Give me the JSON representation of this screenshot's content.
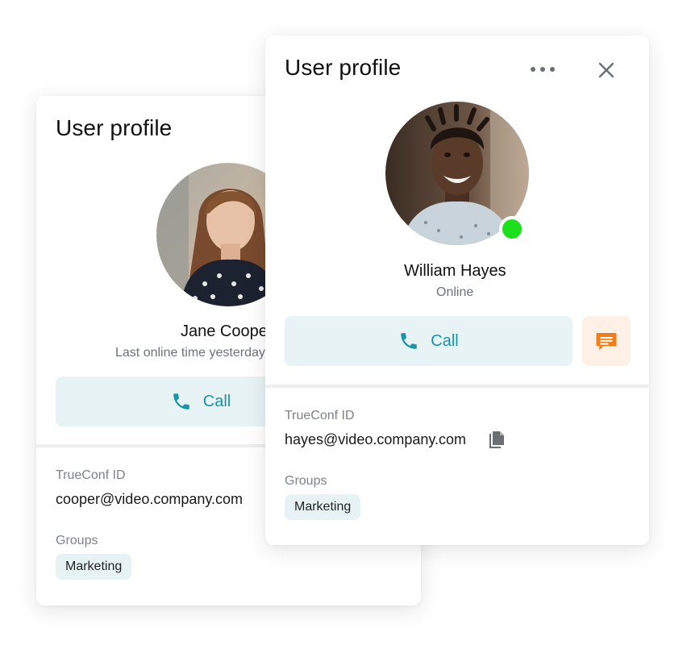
{
  "colors": {
    "accent": "#1894a8",
    "call_bg": "#e8f3f5",
    "chat_bg": "#fdf1e6",
    "chat_icon": "#f07d1a",
    "online": "#1de01d"
  },
  "back_card": {
    "title": "User profile",
    "name": "Jane Cooper",
    "status": "Last online time yesterday",
    "call_label": "Call",
    "id_label": "TrueConf ID",
    "id_value": "cooper@video.company.com",
    "groups_label": "Groups",
    "group_chip": "Marketing"
  },
  "front_card": {
    "title": "User profile",
    "menu_icon": "more-dots-icon",
    "close_icon": "close-icon",
    "name": "William Hayes",
    "status": "Online",
    "call_label": "Call",
    "chat_icon": "chat-icon",
    "id_label": "TrueConf ID",
    "id_value": "hayes@video.company.com",
    "copy_icon": "copy-icon",
    "groups_label": "Groups",
    "group_chip": "Marketing"
  }
}
